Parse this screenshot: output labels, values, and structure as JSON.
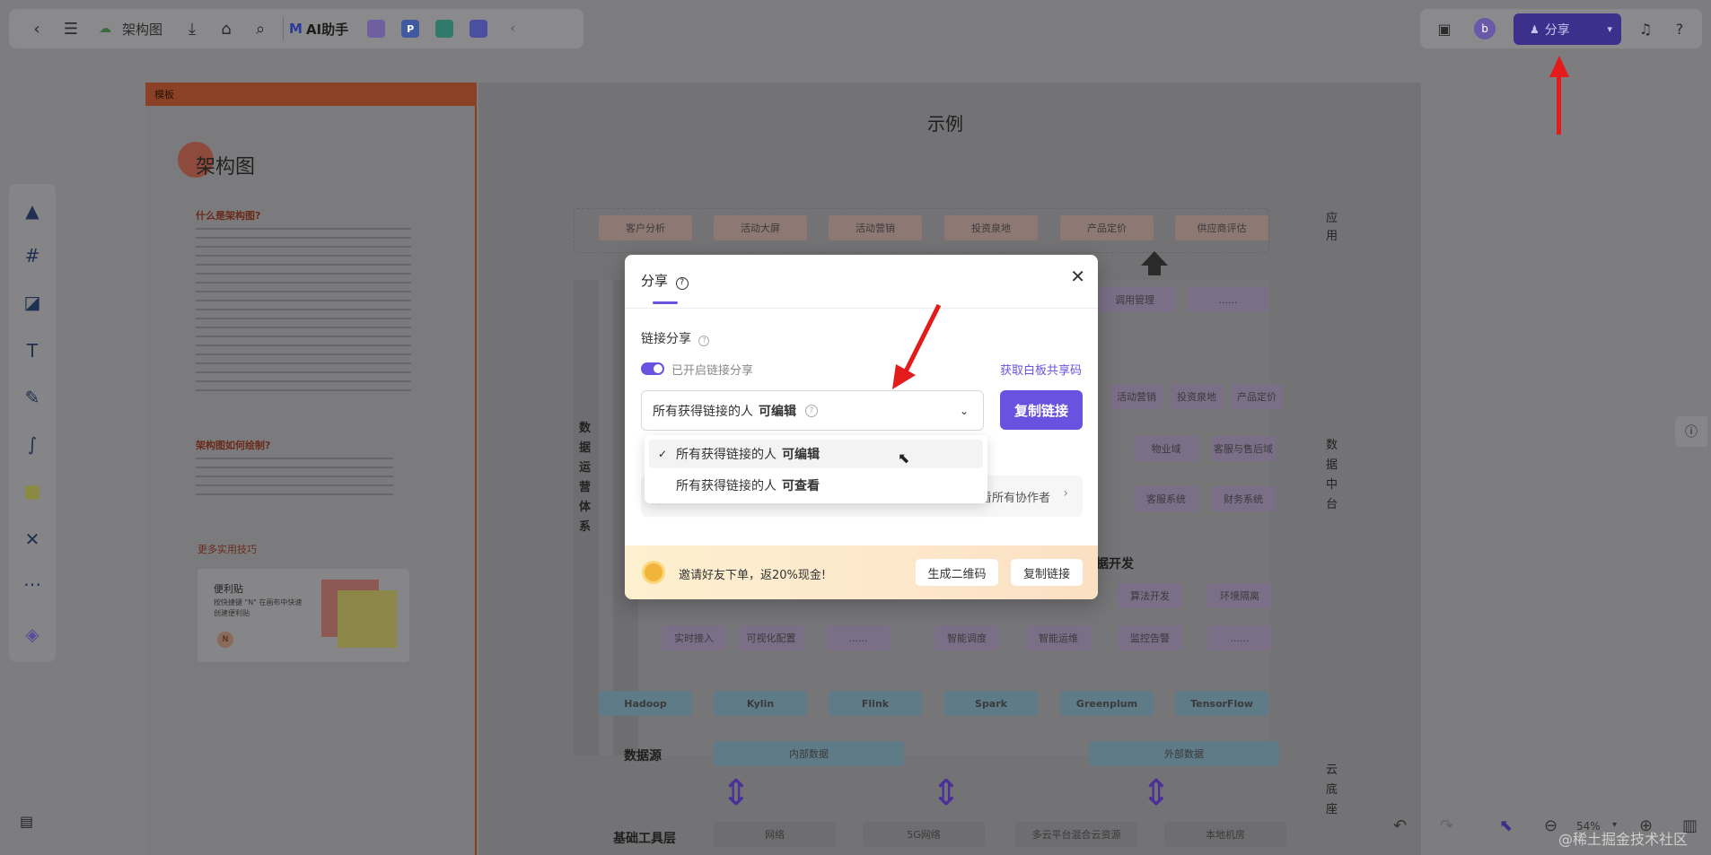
{
  "topbar": {
    "doc_title": "架构图",
    "ai_label": "AI助手",
    "apps": [
      "P"
    ]
  },
  "rightbar": {
    "share_label": "分享"
  },
  "template": {
    "tag": "模板",
    "title": "架构图",
    "q1": "什么是架构图?",
    "q2": "架构图如何绘制?",
    "q3": "更多实用技巧",
    "sticky_title": "便利贴",
    "sticky_desc": "按快捷键 \"N\" 在画布中快速创建便利贴",
    "sticky_key": "N"
  },
  "canvas": {
    "title": "示例",
    "apps": [
      "客户分析",
      "活动大屏",
      "活动营销",
      "投资泉地",
      "产品定价",
      "供应商评估"
    ],
    "side_app": "应用",
    "side_data": "数据中台",
    "side_cloud": "云底座",
    "left_vertical": "数据运营体系",
    "mid_row1": [
      "调用管理",
      "......"
    ],
    "mid_row2": [
      "活动营销",
      "投资泉地",
      "产品定价"
    ],
    "mid_row3": [
      "物业域",
      "客服与售后域"
    ],
    "mid_row4": [
      "客服系统",
      "财务系统"
    ],
    "dev_title": "据开发",
    "dev_row1": [
      "算法开发",
      "环境隔离"
    ],
    "dev_row2_left": [
      "实时接入",
      "可视化配置",
      "......"
    ],
    "dev_row2_right": [
      "智能调度",
      "智能运维",
      "监控告警",
      "......"
    ],
    "tech": [
      "Hadoop",
      "Kylin",
      "Flink",
      "Spark",
      "Greenplum",
      "TensorFlow"
    ],
    "source_label": "数据源",
    "source_items": [
      "内部数据",
      "外部数据"
    ],
    "base_label": "基础工具层",
    "base_items": [
      "网络",
      "5G网络",
      "多云平台混合云资源",
      "本地机房"
    ]
  },
  "modal": {
    "title": "分享",
    "section_label": "链接分享",
    "toggle_label": "已开启链接分享",
    "get_code_link": "获取白板共享码",
    "select_prefix": "所有获得链接的人",
    "select_value": "可编辑",
    "copy_button": "复制链接",
    "collab_link": "查看所有协作者",
    "banner_text": "邀请好友下单，返20%现金!",
    "qr_button": "生成二维码",
    "banner_copy_button": "复制链接"
  },
  "dropdown": {
    "options": [
      {
        "prefix": "所有获得链接的人",
        "perm": "可编辑",
        "selected": true
      },
      {
        "prefix": "所有获得链接的人",
        "perm": "可查看",
        "selected": false
      }
    ]
  },
  "bottom": {
    "zoom": "54%",
    "watermark": "@稀土掘金技术社区"
  },
  "colors": {
    "accent": "#6a52e0",
    "annotation_arrow": "#e31b1b"
  }
}
